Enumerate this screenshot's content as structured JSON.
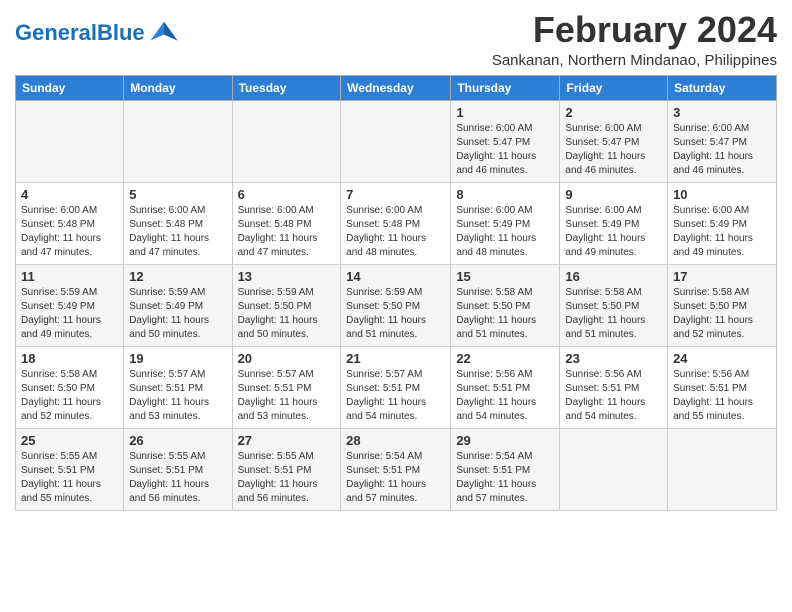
{
  "header": {
    "logo_text_general": "General",
    "logo_text_blue": "Blue",
    "month_title": "February 2024",
    "location": "Sankanan, Northern Mindanao, Philippines"
  },
  "columns": [
    "Sunday",
    "Monday",
    "Tuesday",
    "Wednesday",
    "Thursday",
    "Friday",
    "Saturday"
  ],
  "weeks": [
    [
      {
        "day": "",
        "info": ""
      },
      {
        "day": "",
        "info": ""
      },
      {
        "day": "",
        "info": ""
      },
      {
        "day": "",
        "info": ""
      },
      {
        "day": "1",
        "info": "Sunrise: 6:00 AM\nSunset: 5:47 PM\nDaylight: 11 hours\nand 46 minutes."
      },
      {
        "day": "2",
        "info": "Sunrise: 6:00 AM\nSunset: 5:47 PM\nDaylight: 11 hours\nand 46 minutes."
      },
      {
        "day": "3",
        "info": "Sunrise: 6:00 AM\nSunset: 5:47 PM\nDaylight: 11 hours\nand 46 minutes."
      }
    ],
    [
      {
        "day": "4",
        "info": "Sunrise: 6:00 AM\nSunset: 5:48 PM\nDaylight: 11 hours\nand 47 minutes."
      },
      {
        "day": "5",
        "info": "Sunrise: 6:00 AM\nSunset: 5:48 PM\nDaylight: 11 hours\nand 47 minutes."
      },
      {
        "day": "6",
        "info": "Sunrise: 6:00 AM\nSunset: 5:48 PM\nDaylight: 11 hours\nand 47 minutes."
      },
      {
        "day": "7",
        "info": "Sunrise: 6:00 AM\nSunset: 5:48 PM\nDaylight: 11 hours\nand 48 minutes."
      },
      {
        "day": "8",
        "info": "Sunrise: 6:00 AM\nSunset: 5:49 PM\nDaylight: 11 hours\nand 48 minutes."
      },
      {
        "day": "9",
        "info": "Sunrise: 6:00 AM\nSunset: 5:49 PM\nDaylight: 11 hours\nand 49 minutes."
      },
      {
        "day": "10",
        "info": "Sunrise: 6:00 AM\nSunset: 5:49 PM\nDaylight: 11 hours\nand 49 minutes."
      }
    ],
    [
      {
        "day": "11",
        "info": "Sunrise: 5:59 AM\nSunset: 5:49 PM\nDaylight: 11 hours\nand 49 minutes."
      },
      {
        "day": "12",
        "info": "Sunrise: 5:59 AM\nSunset: 5:49 PM\nDaylight: 11 hours\nand 50 minutes."
      },
      {
        "day": "13",
        "info": "Sunrise: 5:59 AM\nSunset: 5:50 PM\nDaylight: 11 hours\nand 50 minutes."
      },
      {
        "day": "14",
        "info": "Sunrise: 5:59 AM\nSunset: 5:50 PM\nDaylight: 11 hours\nand 51 minutes."
      },
      {
        "day": "15",
        "info": "Sunrise: 5:58 AM\nSunset: 5:50 PM\nDaylight: 11 hours\nand 51 minutes."
      },
      {
        "day": "16",
        "info": "Sunrise: 5:58 AM\nSunset: 5:50 PM\nDaylight: 11 hours\nand 51 minutes."
      },
      {
        "day": "17",
        "info": "Sunrise: 5:58 AM\nSunset: 5:50 PM\nDaylight: 11 hours\nand 52 minutes."
      }
    ],
    [
      {
        "day": "18",
        "info": "Sunrise: 5:58 AM\nSunset: 5:50 PM\nDaylight: 11 hours\nand 52 minutes."
      },
      {
        "day": "19",
        "info": "Sunrise: 5:57 AM\nSunset: 5:51 PM\nDaylight: 11 hours\nand 53 minutes."
      },
      {
        "day": "20",
        "info": "Sunrise: 5:57 AM\nSunset: 5:51 PM\nDaylight: 11 hours\nand 53 minutes."
      },
      {
        "day": "21",
        "info": "Sunrise: 5:57 AM\nSunset: 5:51 PM\nDaylight: 11 hours\nand 54 minutes."
      },
      {
        "day": "22",
        "info": "Sunrise: 5:56 AM\nSunset: 5:51 PM\nDaylight: 11 hours\nand 54 minutes."
      },
      {
        "day": "23",
        "info": "Sunrise: 5:56 AM\nSunset: 5:51 PM\nDaylight: 11 hours\nand 54 minutes."
      },
      {
        "day": "24",
        "info": "Sunrise: 5:56 AM\nSunset: 5:51 PM\nDaylight: 11 hours\nand 55 minutes."
      }
    ],
    [
      {
        "day": "25",
        "info": "Sunrise: 5:55 AM\nSunset: 5:51 PM\nDaylight: 11 hours\nand 55 minutes."
      },
      {
        "day": "26",
        "info": "Sunrise: 5:55 AM\nSunset: 5:51 PM\nDaylight: 11 hours\nand 56 minutes."
      },
      {
        "day": "27",
        "info": "Sunrise: 5:55 AM\nSunset: 5:51 PM\nDaylight: 11 hours\nand 56 minutes."
      },
      {
        "day": "28",
        "info": "Sunrise: 5:54 AM\nSunset: 5:51 PM\nDaylight: 11 hours\nand 57 minutes."
      },
      {
        "day": "29",
        "info": "Sunrise: 5:54 AM\nSunset: 5:51 PM\nDaylight: 11 hours\nand 57 minutes."
      },
      {
        "day": "",
        "info": ""
      },
      {
        "day": "",
        "info": ""
      }
    ]
  ]
}
